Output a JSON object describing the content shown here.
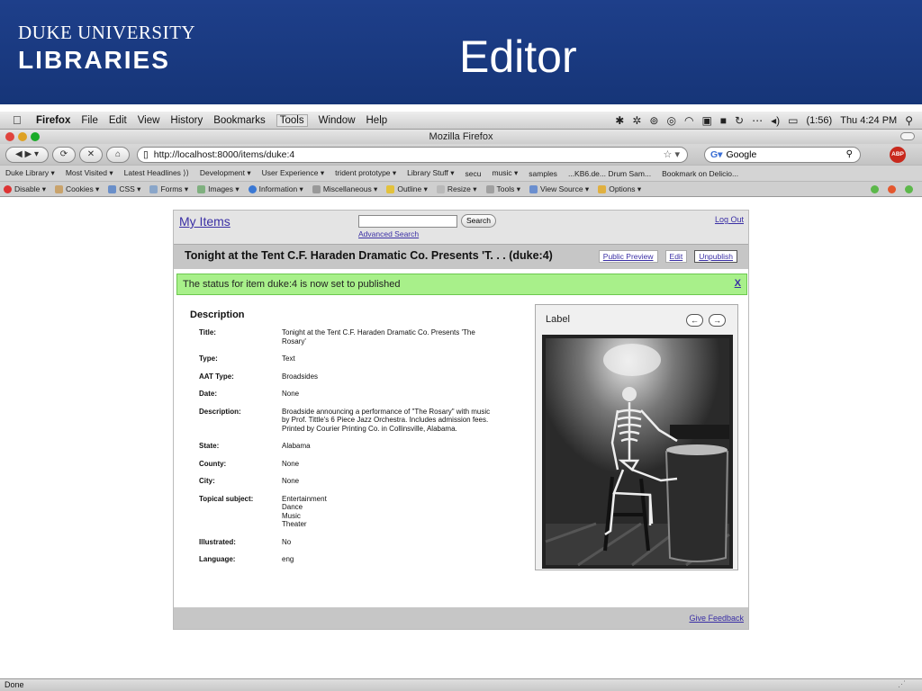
{
  "slide": {
    "logo_line1": "DUKE UNIVERSITY",
    "logo_line2": "LIBRARIES",
    "title": "Editor"
  },
  "menubar": {
    "app": "Firefox",
    "items": [
      "File",
      "Edit",
      "View",
      "History",
      "Bookmarks",
      "Tools",
      "Window",
      "Help"
    ],
    "battery": "(1:56)",
    "clock": "Thu 4:24 PM"
  },
  "window": {
    "title": "Mozilla Firefox"
  },
  "nav": {
    "url": "http://localhost:8000/items/duke:4",
    "search_placeholder": "Google",
    "abp": "ABP"
  },
  "bookmarks": [
    "Duke Library ▾",
    "Most Visited ▾",
    "Latest Headlines ⟩⟩",
    "Development ▾",
    "User Experience ▾",
    "trident prototype ▾",
    "Library Stuff ▾",
    "secu",
    "music ▾",
    "samples",
    "...KB6.de... Drum Sam...",
    "Bookmark on Delicio..."
  ],
  "devbar": [
    "Disable ▾",
    "Cookies ▾",
    "CSS ▾",
    "Forms ▾",
    "Images ▾",
    "Information ▾",
    "Miscellaneous ▾",
    "Outline ▾",
    "Resize ▾",
    "Tools ▾",
    "View Source ▾",
    "Options ▾"
  ],
  "page": {
    "my_items": "My Items",
    "search_button": "Search",
    "advanced_search": "Advanced Search",
    "log_out": "Log Out",
    "item_title": "Tonight at the Tent C.F. Haraden Dramatic Co. Presents 'T. . . (duke:4)",
    "public_preview": "Public Preview",
    "edit": "Edit",
    "unpublish": "Unpublish",
    "status_message": "The status for item duke:4 is now set to published",
    "status_close": "X",
    "description_heading": "Description",
    "fields": [
      {
        "label": "Title:",
        "values": [
          "Tonight at the Tent C.F. Haraden Dramatic Co. Presents 'The",
          "Rosary'"
        ]
      },
      {
        "label": "Type:",
        "values": [
          "Text"
        ]
      },
      {
        "label": "AAT Type:",
        "values": [
          "Broadsides"
        ]
      },
      {
        "label": "Date:",
        "values": [
          "None"
        ]
      },
      {
        "label": "Description:",
        "values": [
          "Broadside announcing a performance of \"The Rosary\" with music",
          "by Prof. Tittle's 6 Piece Jazz Orchestra. Includes admission fees.",
          "Printed by Courier Printing Co. in Collinsville, Alabama."
        ]
      },
      {
        "label": "State:",
        "values": [
          "Alabama"
        ]
      },
      {
        "label": "County:",
        "values": [
          "None"
        ]
      },
      {
        "label": "City:",
        "values": [
          "None"
        ]
      },
      {
        "label": "Topical subject:",
        "values": [
          "Entertainment",
          "Dance",
          "Music",
          "Theater"
        ]
      },
      {
        "label": "Illustrated:",
        "values": [
          "No"
        ]
      },
      {
        "label": "Language:",
        "values": [
          "eng"
        ]
      }
    ],
    "viewer_label": "Label",
    "prev_arrow": "←",
    "next_arrow": "→",
    "give_feedback": "Give Feedback"
  },
  "statusbar": {
    "text": "Done"
  }
}
